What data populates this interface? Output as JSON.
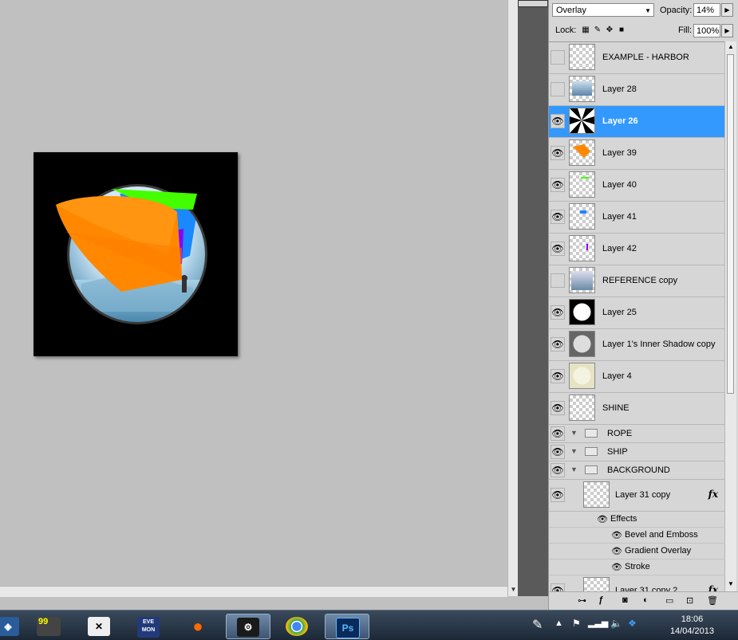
{
  "layers_panel": {
    "blend_mode": "Overlay",
    "opacity_label": "Opacity:",
    "opacity_value": "14%",
    "lock_label": "Lock:",
    "fill_label": "Fill:",
    "fill_value": "100%",
    "layers": [
      {
        "name": "EXAMPLE - HARBOR",
        "visible": false
      },
      {
        "name": "Layer 28",
        "visible": false
      },
      {
        "name": "Layer 26",
        "visible": true,
        "selected": true
      },
      {
        "name": "Layer 39",
        "visible": true
      },
      {
        "name": "Layer 40",
        "visible": true
      },
      {
        "name": "Layer 41",
        "visible": true
      },
      {
        "name": "Layer 42",
        "visible": true
      },
      {
        "name": "REFERENCE copy",
        "visible": false
      },
      {
        "name": "Layer 25",
        "visible": true
      },
      {
        "name": "Layer 1's Inner Shadow copy",
        "visible": true
      },
      {
        "name": "Layer 4",
        "visible": true
      },
      {
        "name": "SHINE",
        "visible": true
      }
    ],
    "groups": [
      {
        "name": "ROPE"
      },
      {
        "name": "SHIP"
      },
      {
        "name": "BACKGROUND"
      }
    ],
    "sub_layers": [
      {
        "name": "Layer 31 copy",
        "fx": "fx"
      },
      {
        "name": "Layer 31 copy 2",
        "fx": "fx"
      }
    ],
    "effects_label": "Effects",
    "effects": [
      "Bevel and Emboss",
      "Gradient Overlay",
      "Stroke"
    ]
  },
  "taskbar": {
    "badge": "99",
    "apps": [
      "EVE MON",
      "Ps"
    ],
    "time": "18:06",
    "date": "14/04/2013"
  },
  "colors": {
    "selection": "#3399ff",
    "panel_bg": "#d6d6d6",
    "canvas_bg": "#c0c0c0",
    "orange": "#ff8800",
    "green": "#44ff00",
    "blue": "#1a88ff",
    "purple": "#8800ff"
  }
}
